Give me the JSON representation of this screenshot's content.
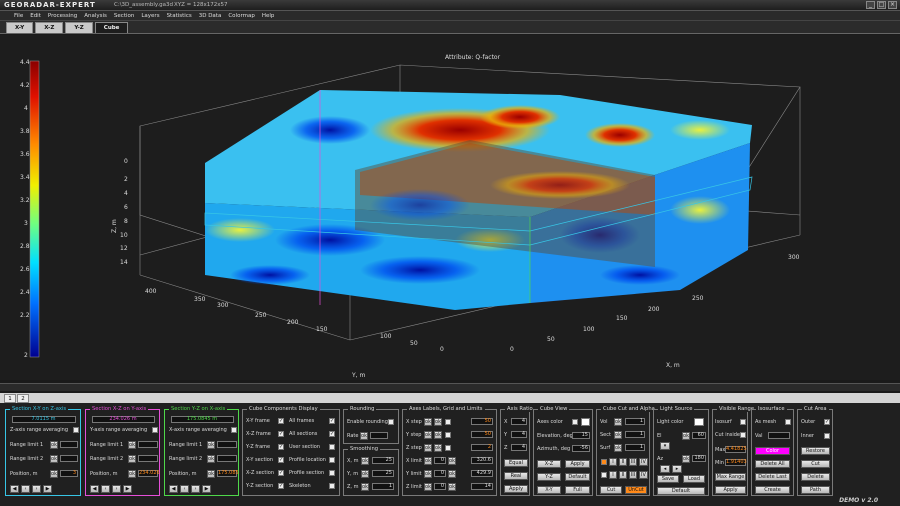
{
  "app": {
    "logo": "GEORADAR-EXPERT",
    "file": "C:\\3D_assembly.ga3d",
    "xyz": "XYZ = 128x172x57",
    "demo": "DEMO v 2.0"
  },
  "menu": [
    "File",
    "Edit",
    "Processing",
    "Analysis",
    "Section",
    "Layers",
    "Statistics",
    "3D Data",
    "Colormap",
    "Help"
  ],
  "tabs": [
    "X-Y",
    "X-Z",
    "Y-Z",
    "Cube"
  ],
  "plot": {
    "title": "Attribute: Q-factor",
    "zlabel": "Z, m",
    "ylabel": "Y, m",
    "xlabel": "X, m",
    "colorbar_ticks": [
      "4.4",
      "4.2",
      "4",
      "3.8",
      "3.6",
      "3.4",
      "3.2",
      "3",
      "2.8",
      "2.6",
      "2.4",
      "2.2",
      "2"
    ],
    "z_ticks": [
      "0",
      "2",
      "4",
      "6",
      "8",
      "10",
      "12",
      "14"
    ],
    "y_ticks": [
      "400",
      "350",
      "300",
      "250",
      "200",
      "150",
      "100",
      "50",
      "0"
    ],
    "x_ticks": [
      "0",
      "50",
      "100",
      "150",
      "200",
      "250",
      "300"
    ]
  },
  "bottom_tabs": [
    "1",
    "2"
  ],
  "panels": {
    "sxy": {
      "title": "Section X-Y on Z-axis",
      "value": "7.0115 m",
      "avg": "Z-axis range averaging",
      "l1": "Range limit 1",
      "l2": "Range limit 2",
      "pos": "Position, m",
      "posval": "3"
    },
    "sxz": {
      "title": "Section X-Z on Y-axis",
      "value": "234.026 m",
      "avg": "Y-axis range averaging",
      "l1": "Range limit 1",
      "l2": "Range limit 2",
      "pos": "Position, m",
      "posval": "234.026"
    },
    "syz": {
      "title": "Section Y-Z on X-axis",
      "value": "175.0845 m",
      "avg": "X-axis range averaging",
      "l1": "Range limit 1",
      "l2": "Range limit 2",
      "pos": "Position, m",
      "posval": "175.085"
    },
    "ccd": {
      "title": "Cube Components Display",
      "left": [
        "X-Y frame",
        "X-Z frame",
        "Y-Z frame",
        "X-Y section",
        "X-Z section",
        "Y-Z section"
      ],
      "right": [
        "All frames",
        "All sections",
        "User section",
        "Profile location",
        "Profile section",
        "Skeleton"
      ]
    },
    "round": {
      "title": "Rounding",
      "enable": "Enable rounding",
      "rate": "Rate"
    },
    "smooth": {
      "title": "Smoothing",
      "x": "X, m",
      "y": "Y, m",
      "z": "Z, m",
      "xv": "25",
      "yv": "25",
      "zv": "1"
    },
    "axes": {
      "title": "Axes Labels, Grid and Limits",
      "rows": [
        "X step",
        "Y step",
        "Z step",
        "X limit",
        "Y limit",
        "Z limit"
      ],
      "v1": [
        "50",
        "50",
        "2",
        "0",
        "0",
        "0"
      ],
      "v2": [
        "",
        "",
        "",
        "320.6",
        "429.9",
        "14"
      ]
    },
    "ratio": {
      "title": "Axis Ratio",
      "x": "X",
      "y": "Y",
      "z": "Z",
      "xv": "4",
      "yv": "4",
      "zv": "4",
      "b1": "Equal",
      "b2": "Real",
      "b3": "Apply"
    },
    "view": {
      "title": "Cube View",
      "axes": "Axes color",
      "elev": "Elevation, deg",
      "azi": "Azimuth, deg",
      "elevv": "15",
      "aziv": "-56",
      "b": [
        "X-Z",
        "Apply",
        "Y-Z",
        "Default",
        "X-Y",
        "Full"
      ]
    },
    "cut": {
      "title": "Cube Cut and Alpha",
      "vol": "Vol",
      "sect": "Sect",
      "surf": "Surf",
      "vv": "1",
      "sv": "1",
      "fv": "1",
      "r": [
        "I",
        "II",
        "III",
        "IV"
      ],
      "b1": "Cut",
      "b2": "UnCut"
    },
    "light": {
      "title": "Light Source",
      "color": "Light color",
      "el": "El",
      "az": "Az",
      "elv": "60",
      "azv": "180",
      "b1": "Save",
      "b2": "Load",
      "b3": "Default"
    },
    "vis": {
      "title": "Visible Range",
      "iso": "Isosurf",
      "inside": "Cut inside",
      "max": "Max",
      "min": "Min",
      "maxv": "4.41825",
      "minv": "1.91403",
      "b1": "Max Range",
      "b2": "Apply"
    },
    "isos": {
      "title": "Isosurface",
      "mesh": "As mesh",
      "val": "Val",
      "b1": "Color",
      "b2": "Delete All",
      "b3": "Delete Last",
      "b4": "Create"
    },
    "area": {
      "title": "Cut Area",
      "outer": "Outer",
      "inner": "Inner",
      "b1": "Restore",
      "b2": "Cut",
      "b3": "Delete",
      "b4": "Path"
    }
  },
  "colors": {
    "accent_xy": "#37c6e6",
    "accent_xz": "#e64fd8",
    "accent_yz": "#4fd84a",
    "uncut": "#ff8a1a",
    "iso_color": "#ff00ff"
  }
}
